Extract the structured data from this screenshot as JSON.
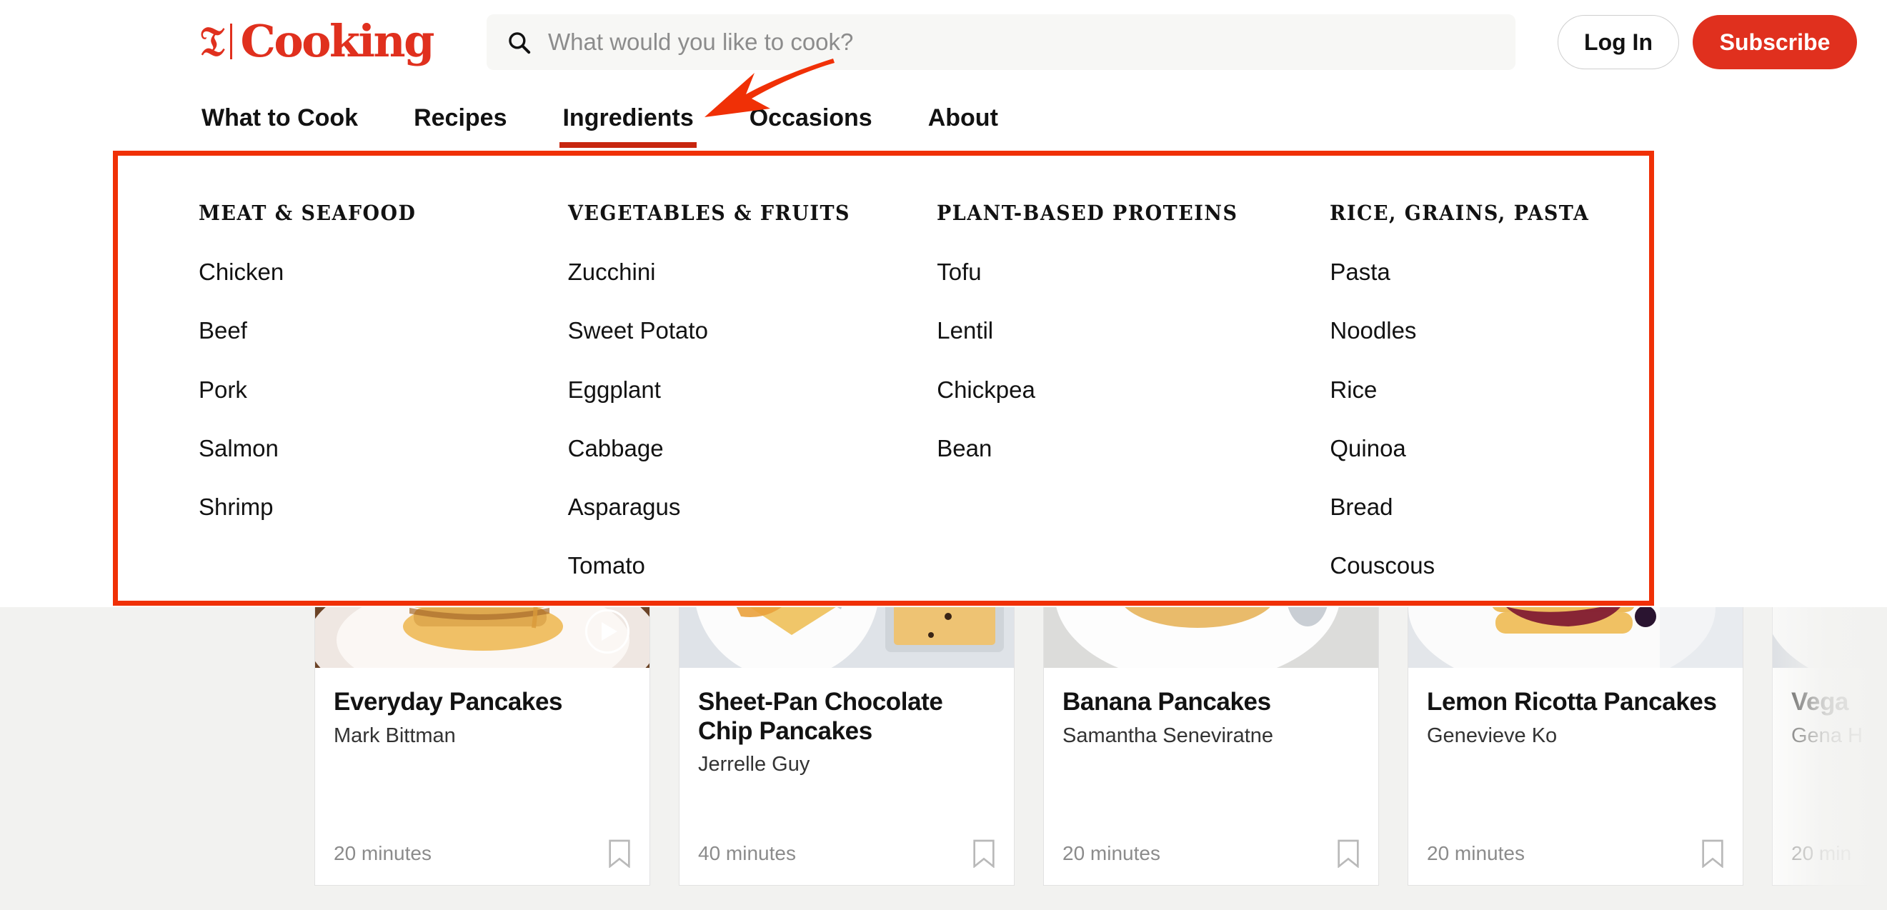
{
  "brand": {
    "logo_mark": "nyt-t-icon",
    "logo_text": "Cooking",
    "accent_color": "#e0301e",
    "annotation_color": "#f03006"
  },
  "search": {
    "icon": "search-icon",
    "placeholder": "What would you like to cook?",
    "value": ""
  },
  "account": {
    "login_label": "Log In",
    "subscribe_label": "Subscribe"
  },
  "nav": {
    "items": [
      {
        "label": "What to Cook",
        "active": false
      },
      {
        "label": "Recipes",
        "active": false
      },
      {
        "label": "Ingredients",
        "active": true
      },
      {
        "label": "Occasions",
        "active": false
      },
      {
        "label": "About",
        "active": false
      }
    ]
  },
  "dropdown": {
    "open_for": "Ingredients",
    "columns": [
      {
        "heading": "MEAT & SEAFOOD",
        "items": [
          "Chicken",
          "Beef",
          "Pork",
          "Salmon",
          "Shrimp"
        ]
      },
      {
        "heading": "VEGETABLES & FRUITS",
        "items": [
          "Zucchini",
          "Sweet Potato",
          "Eggplant",
          "Cabbage",
          "Asparagus",
          "Tomato"
        ]
      },
      {
        "heading": "PLANT-BASED PROTEINS",
        "items": [
          "Tofu",
          "Lentil",
          "Chickpea",
          "Bean"
        ]
      },
      {
        "heading": "RICE, GRAINS, PASTA",
        "items": [
          "Pasta",
          "Noodles",
          "Rice",
          "Quinoa",
          "Bread",
          "Couscous"
        ]
      }
    ]
  },
  "rail": {
    "cards": [
      {
        "title": "Everyday Pancakes",
        "author": "Mark Bittman",
        "time": "20 minutes",
        "has_video": true,
        "bookmark_icon": "bookmark-icon",
        "play_icon": "play-icon",
        "image_alt": "stack-of-pancakes-on-floral-plate"
      },
      {
        "title": "Sheet-Pan Chocolate Chip Pancakes",
        "author": "Jerrelle Guy",
        "time": "40 minutes",
        "has_video": false,
        "bookmark_icon": "bookmark-icon",
        "image_alt": "sheet-pan-chocolate-chip-pancake-slice-with-fork"
      },
      {
        "title": "Banana Pancakes",
        "author": "Samantha Seneviratne",
        "time": "20 minutes",
        "has_video": false,
        "bookmark_icon": "bookmark-icon",
        "image_alt": "banana-pancakes-with-butter-and-syrup"
      },
      {
        "title": "Lemon Ricotta Pancakes",
        "author": "Genevieve Ko",
        "time": "20 minutes",
        "has_video": false,
        "bookmark_icon": "bookmark-icon",
        "image_alt": "lemon-ricotta-pancakes-with-berry-compote"
      },
      {
        "title": "Vega",
        "author": "Gena H",
        "time": "20 min",
        "has_video": false,
        "bookmark_icon": "bookmark-icon",
        "image_alt": "partially-visible-card-faded"
      }
    ]
  },
  "annotations": {
    "highlight_box_target": "ingredients-dropdown-panel",
    "arrow_target": "nav-item-ingredients"
  }
}
